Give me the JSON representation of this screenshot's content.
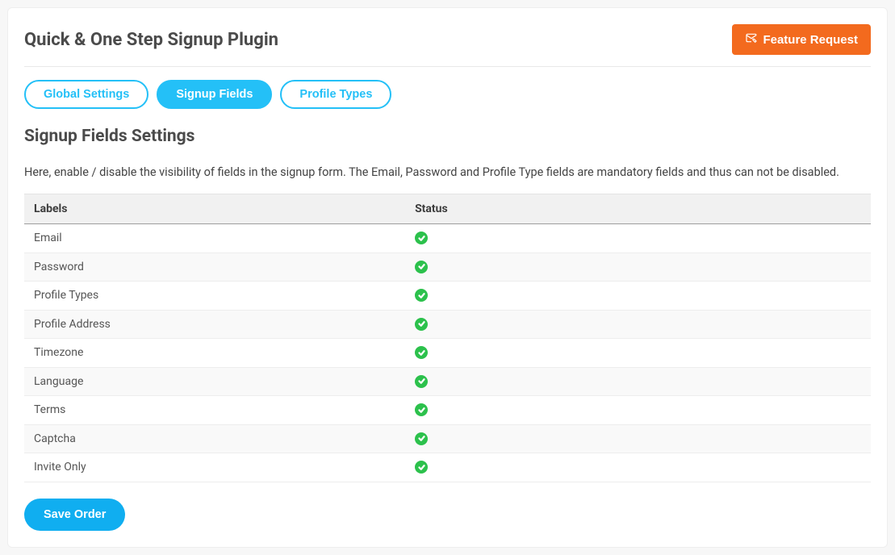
{
  "header": {
    "title": "Quick & One Step Signup Plugin",
    "feature_request_label": "Feature Request"
  },
  "tabs": {
    "global": "Global Settings",
    "signup": "Signup Fields",
    "profile": "Profile Types"
  },
  "section_title": "Signup Fields Settings",
  "description": "Here, enable / disable the visibility of fields in the signup form. The Email, Password and Profile Type fields are mandatory fields and thus can not be disabled.",
  "table": {
    "head_labels": "Labels",
    "head_status": "Status",
    "rows": [
      {
        "label": "Email",
        "status": "enabled"
      },
      {
        "label": "Password",
        "status": "enabled"
      },
      {
        "label": "Profile Types",
        "status": "enabled"
      },
      {
        "label": "Profile Address",
        "status": "enabled"
      },
      {
        "label": "Timezone",
        "status": "enabled"
      },
      {
        "label": "Language",
        "status": "enabled"
      },
      {
        "label": "Terms",
        "status": "enabled"
      },
      {
        "label": "Captcha",
        "status": "enabled"
      },
      {
        "label": "Invite Only",
        "status": "enabled"
      }
    ]
  },
  "save_label": "Save Order"
}
